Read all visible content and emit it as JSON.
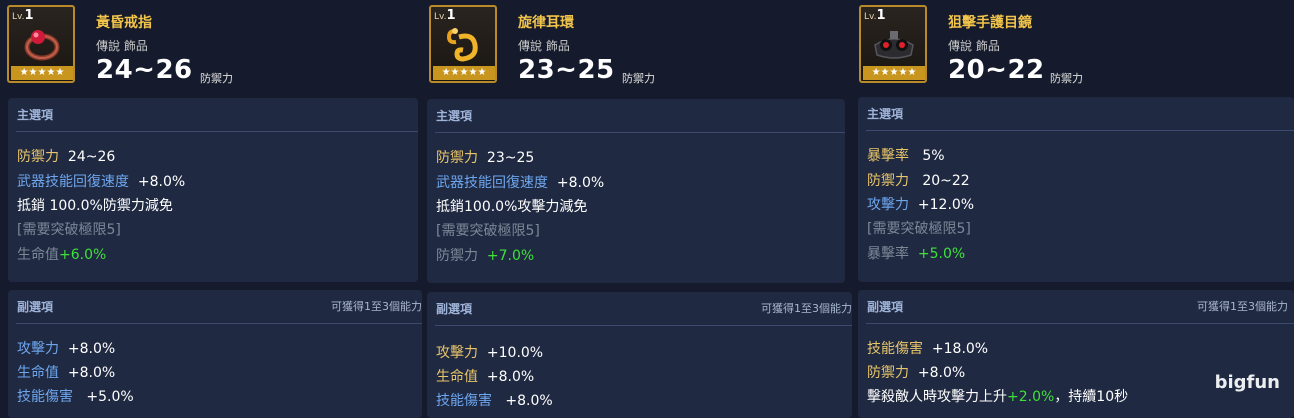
{
  "labels": {
    "main_title": "主選項",
    "sub_title": "副選項",
    "sub_hint": "可獲得1至3個能力"
  },
  "cards": [
    {
      "level_prefix": "Lv.",
      "level": "1",
      "stars": "★★★★★",
      "name": "黃昏戒指",
      "subtitle": "傳說  飾品",
      "value": "24~26",
      "value_label": "防禦力",
      "main": [
        {
          "label": "防禦力",
          "value": "24~26",
          "lc": "gold",
          "vc": "white"
        },
        {
          "label": "武器技能回復速度",
          "value": "+8.0%",
          "lc": "blue",
          "vc": "white"
        },
        {
          "label": "抵銷  100.0%防禦力減免",
          "value": "",
          "lc": "white",
          "vc": "white"
        },
        {
          "label": "[需要突破極限5]",
          "value": "",
          "lc": "gray",
          "vc": "gray"
        },
        {
          "label": "生命值",
          "value": "+6.0%",
          "lc": "gray",
          "vc": "green"
        }
      ],
      "sub": [
        {
          "label": "攻擊力",
          "value": "+8.0%",
          "lc": "blue",
          "vc": "white"
        },
        {
          "label": "生命值",
          "value": "+8.0%",
          "lc": "blue",
          "vc": "white"
        },
        {
          "label": "技能傷害",
          "value": "+5.0%",
          "lc": "blue",
          "vc": "white"
        }
      ]
    },
    {
      "level_prefix": "Lv.",
      "level": "1",
      "stars": "★★★★★",
      "name": "旋律耳環",
      "subtitle": "傳說  飾品",
      "value": "23~25",
      "value_label": "防禦力",
      "main": [
        {
          "label": "防禦力",
          "value": "23~25",
          "lc": "gold",
          "vc": "white"
        },
        {
          "label": "武器技能回復速度",
          "value": "+8.0%",
          "lc": "blue",
          "vc": "white"
        },
        {
          "label": "抵銷100.0%攻擊力減免",
          "value": "",
          "lc": "white",
          "vc": "white"
        },
        {
          "label": "[需要突破極限5]",
          "value": "",
          "lc": "gray",
          "vc": "gray"
        },
        {
          "label": "防禦力",
          "value": "+7.0%",
          "lc": "gray",
          "vc": "green"
        }
      ],
      "sub": [
        {
          "label": "攻擊力",
          "value": "+10.0%",
          "lc": "gold",
          "vc": "white"
        },
        {
          "label": "生命值",
          "value": "+8.0%",
          "lc": "gold",
          "vc": "white"
        },
        {
          "label": "技能傷害",
          "value": "+8.0%",
          "lc": "blue",
          "vc": "white"
        }
      ]
    },
    {
      "level_prefix": "Lv.",
      "level": "1",
      "stars": "★★★★★",
      "name": "狙擊手護目鏡",
      "subtitle": "傳說  飾品",
      "value": "20~22",
      "value_label": "防禦力",
      "main": [
        {
          "label": "暴擊率",
          "value": "5%",
          "lc": "gold",
          "vc": "white"
        },
        {
          "label": "防禦力",
          "value": "20~22",
          "lc": "gold",
          "vc": "white"
        },
        {
          "label": "攻擊力",
          "value": "+12.0%",
          "lc": "blue",
          "vc": "white"
        },
        {
          "label": "[需要突破極限5]",
          "value": "",
          "lc": "gray",
          "vc": "gray"
        },
        {
          "label": "暴擊率",
          "value": "+5.0%",
          "lc": "gray",
          "vc": "green"
        }
      ],
      "sub": [
        {
          "label": "技能傷害",
          "value": "+18.0%",
          "lc": "gold",
          "vc": "white"
        },
        {
          "label": "防禦力",
          "value": "+8.0%",
          "lc": "gold",
          "vc": "white"
        },
        {
          "label": "擊殺敵人時攻擊力上升",
          "value": "+2.0%",
          "tail": "，持續10秒",
          "lc": "white",
          "vc": "green"
        }
      ]
    }
  ],
  "watermark": "bigfun"
}
